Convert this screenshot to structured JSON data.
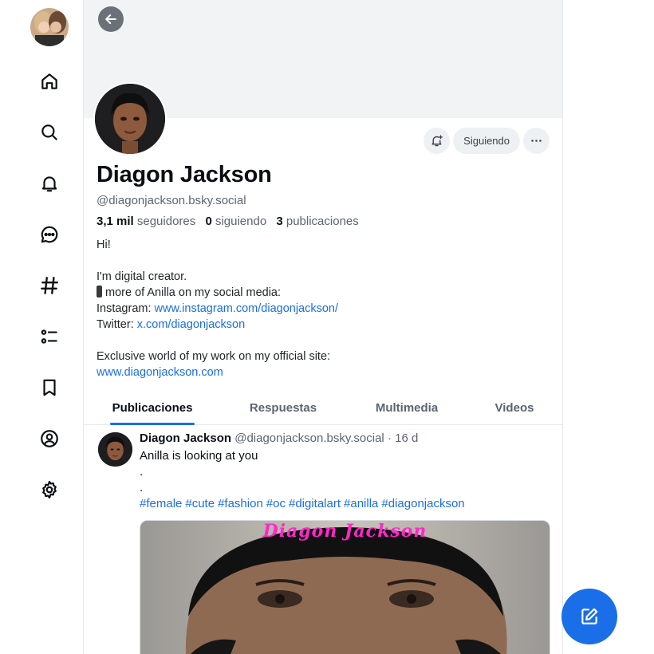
{
  "nav": {
    "items": [
      {
        "name": "home"
      },
      {
        "name": "search"
      },
      {
        "name": "notifications"
      },
      {
        "name": "chat"
      },
      {
        "name": "feeds"
      },
      {
        "name": "lists"
      },
      {
        "name": "saved"
      },
      {
        "name": "profile"
      },
      {
        "name": "settings"
      }
    ]
  },
  "profile": {
    "display_name": "Diagon Jackson",
    "handle": "@diagonjackson.bsky.social",
    "followers_count": "3,1 mil",
    "followers_label": "seguidores",
    "following_count": "0",
    "following_label": "siguiendo",
    "posts_count": "3",
    "posts_label": "publicaciones",
    "follow_button": "Siguiendo"
  },
  "bio": {
    "line1": "Hi!",
    "line2": "I'm digital creator.",
    "line3": "more of Anilla on my social media:",
    "instagram_label": "Instagram: ",
    "instagram_link": "www.instagram.com/diagonjackson/",
    "twitter_label": "Twitter: ",
    "twitter_link": "x.com/diagonjackson",
    "line6": "Exclusive world of my work on my official site:",
    "site_link": "www.diagonjackson.com"
  },
  "tabs": [
    {
      "label": "Publicaciones",
      "active": true
    },
    {
      "label": "Respuestas",
      "active": false
    },
    {
      "label": "Multimedia",
      "active": false
    },
    {
      "label": "Videos",
      "active": false
    }
  ],
  "post": {
    "author": "Diagon Jackson",
    "handle": "@diagonjackson.bsky.social",
    "time": "· 16 d",
    "text": "Anilla is looking at you",
    "dot1": ".",
    "dot2": ".",
    "tags": [
      "#female",
      "#cute",
      "#fashion",
      "#oc",
      "#digitalart",
      "#anilla",
      "#diagonjackson"
    ],
    "watermark": "Diagon Jackson"
  },
  "colors": {
    "accent": "#1a6ee8",
    "muted": "#5b6570",
    "watermark": "#ff28c8"
  }
}
